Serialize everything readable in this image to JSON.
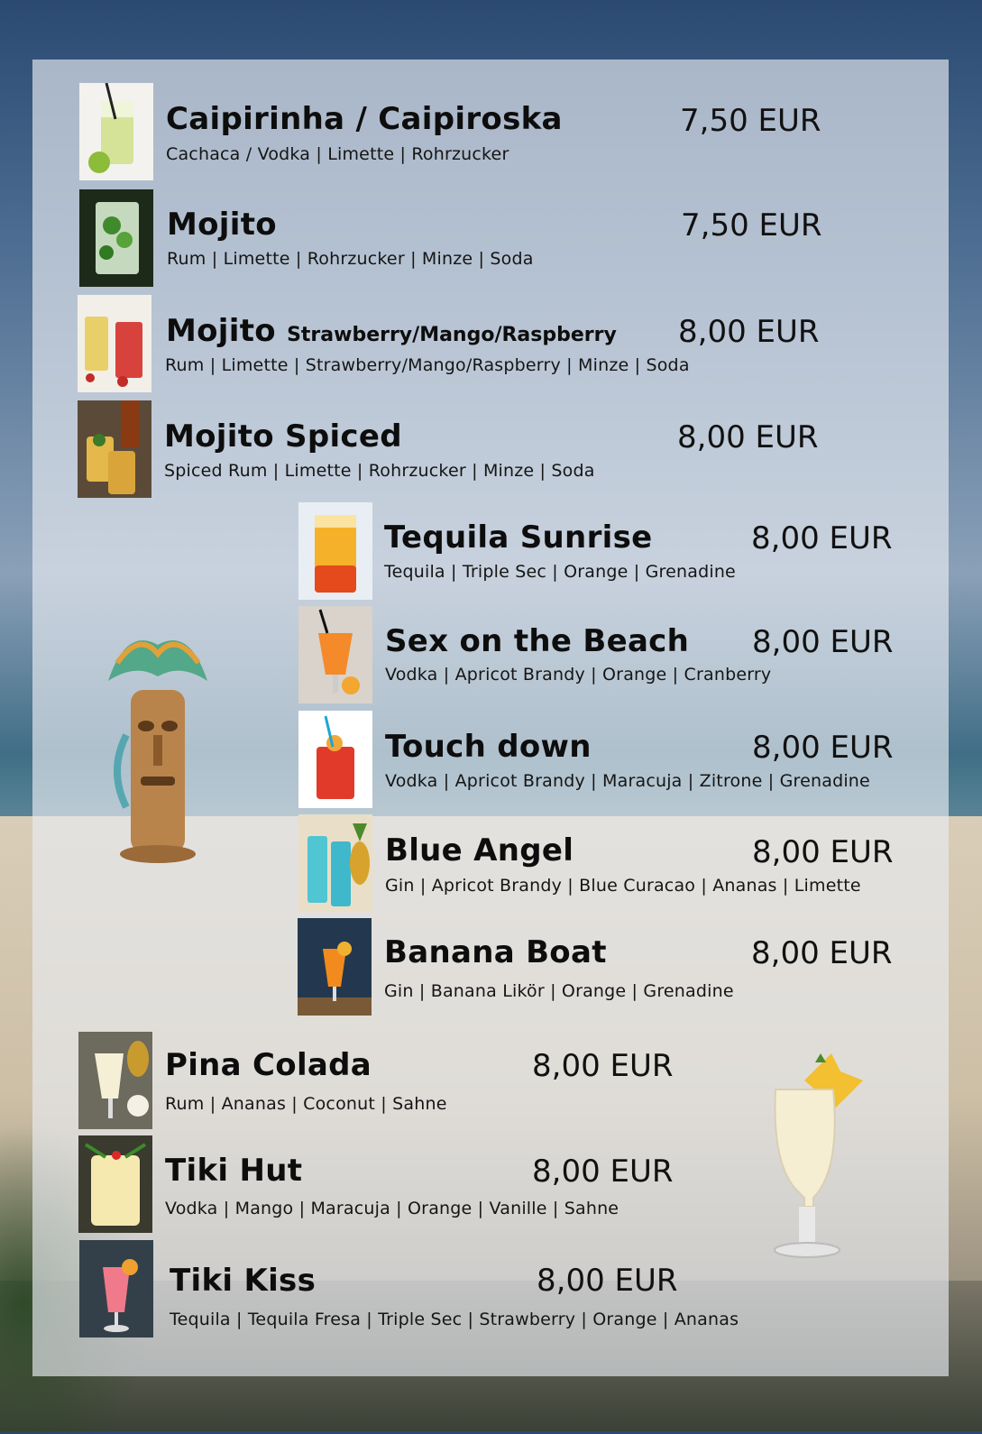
{
  "menu": {
    "items": [
      {
        "name": "Caipirinha / Caipiroska",
        "variant": "",
        "price": "7,50 EUR",
        "ingredients": "Cachaca / Vodka | Limette | Rohrzucker",
        "image": "lime-cocktail"
      },
      {
        "name": "Mojito",
        "variant": "",
        "price": "7,50 EUR",
        "ingredients": "Rum | Limette | Rohrzucker | Minze | Soda",
        "image": "mint-cocktail"
      },
      {
        "name": "Mojito",
        "variant": "Strawberry/Mango/Raspberry",
        "price": "8,00 EUR",
        "ingredients": "Rum | Limette | Strawberry/Mango/Raspberry | Minze | Soda",
        "image": "fruit-mojito"
      },
      {
        "name": "Mojito Spiced",
        "variant": "",
        "price": "8,00 EUR",
        "ingredients": "Spiced Rum | Limette | Rohrzucker | Minze | Soda",
        "image": "spiced-mojito"
      },
      {
        "name": "Tequila Sunrise",
        "variant": "",
        "price": "8,00 EUR",
        "ingredients": "Tequila | Triple Sec | Orange | Grenadine",
        "image": "sunrise-cocktail"
      },
      {
        "name": "Sex on the Beach",
        "variant": "",
        "price": "8,00 EUR",
        "ingredients": "Vodka | Apricot Brandy | Orange | Cranberry",
        "image": "orange-cocktail"
      },
      {
        "name": "Touch down",
        "variant": "",
        "price": "8,00 EUR",
        "ingredients": "Vodka | Apricot Brandy | Maracuja | Zitrone | Grenadine",
        "image": "red-cocktail"
      },
      {
        "name": "Blue Angel",
        "variant": "",
        "price": "8,00 EUR",
        "ingredients": "Gin | Apricot Brandy | Blue Curacao | Ananas | Limette",
        "image": "blue-cocktail"
      },
      {
        "name": "Banana Boat",
        "variant": "",
        "price": "8,00 EUR",
        "ingredients": "Gin | Banana Likör | Orange | Grenadine",
        "image": "banana-cocktail"
      },
      {
        "name": "Pina Colada",
        "variant": "",
        "price": "8,00 EUR",
        "ingredients": "Rum | Ananas | Coconut | Sahne",
        "image": "pina-colada"
      },
      {
        "name": "Tiki Hut",
        "variant": "",
        "price": "8,00 EUR",
        "ingredients": "Vodka | Mango | Maracuja | Orange | Vanille | Sahne",
        "image": "cream-cocktail"
      },
      {
        "name": "Tiki Kiss",
        "variant": "",
        "price": "8,00 EUR",
        "ingredients": "Tequila | Tequila Fresa | Triple Sec | Strawberry | Orange | Ananas",
        "image": "pink-cocktail"
      }
    ]
  },
  "decorations": {
    "left": "tiki-statue-icon",
    "right": "pina-colada-glass-icon"
  },
  "colors": {
    "text": "#0d0d0d",
    "panel": "#e8ecf2"
  }
}
